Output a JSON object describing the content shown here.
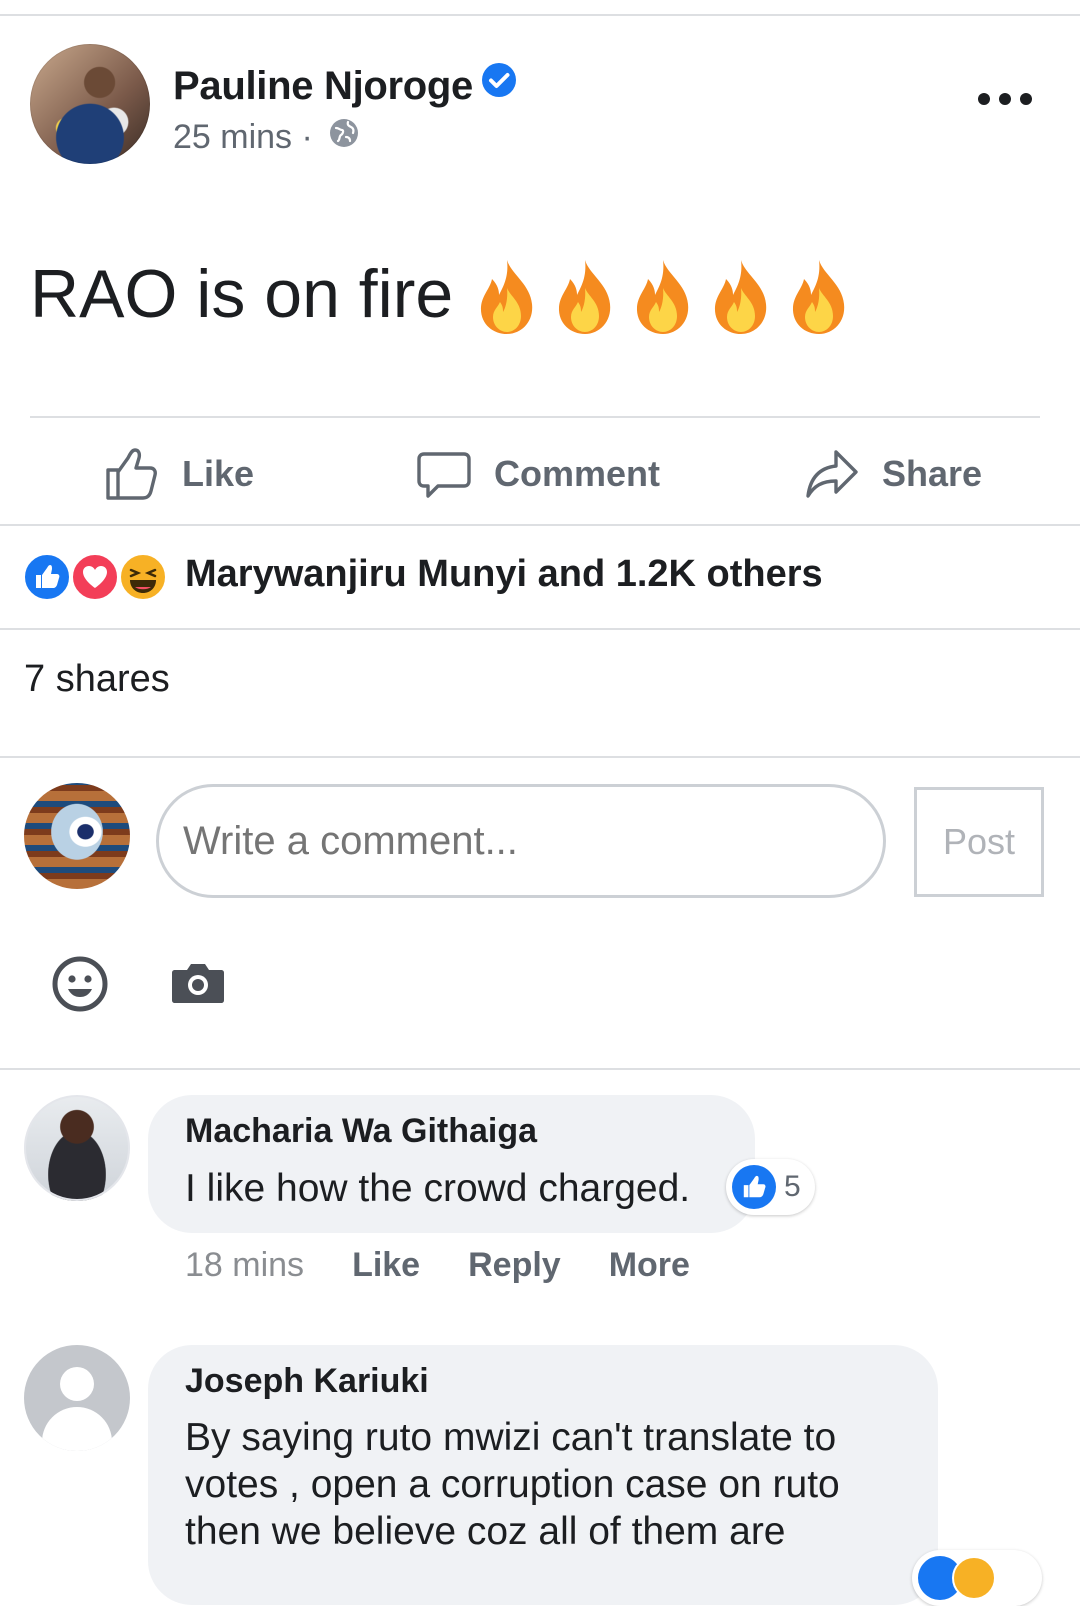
{
  "post": {
    "author": "Pauline Njoroge",
    "time": "25 mins ·",
    "text": "RAO is on fire",
    "emoji_count": 5
  },
  "actions": {
    "like": "Like",
    "comment": "Comment",
    "share": "Share"
  },
  "reactions": {
    "summary": "Marywanjiru Munyi and 1.2K others",
    "types": [
      "like",
      "love",
      "haha"
    ]
  },
  "shares": "7 shares",
  "composer": {
    "placeholder": "Write a comment...",
    "post_label": "Post"
  },
  "comments": [
    {
      "name": "Macharia Wa Githaiga",
      "text": "I like how the crowd charged.",
      "reaction_count": "5",
      "time": "18 mins",
      "like": "Like",
      "reply": "Reply",
      "more": "More"
    },
    {
      "name": "Joseph Kariuki",
      "text": "By saying ruto mwizi can't translate to votes , open a corruption case on ruto then we believe coz all of them are"
    }
  ],
  "colors": {
    "facebook_blue": "#1877f2",
    "secondary_text": "#606770",
    "bubble_bg": "#f0f2f5",
    "divider": "#dddfe2"
  }
}
